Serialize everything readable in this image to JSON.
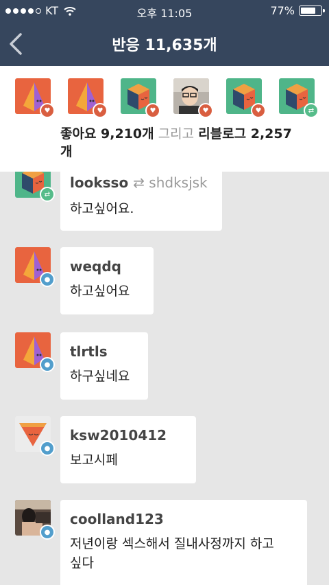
{
  "status_bar": {
    "carrier": "KT",
    "time": "오후 11:05",
    "battery_pct": "77%",
    "battery_level": 0.77,
    "signal_bars": 4
  },
  "nav": {
    "title": "반응 11,635개",
    "back_icon": "chevron-left-icon"
  },
  "summary": {
    "likes": "좋아요 9,210개",
    "conj": "그리고",
    "reblogs": "리블로그 2,257",
    "reblogs_unit": "개"
  },
  "avatars": [
    {
      "style": "pyramid",
      "badge": "like"
    },
    {
      "style": "pyramid",
      "badge": "like"
    },
    {
      "style": "cube",
      "badge": "like"
    },
    {
      "style": "photo",
      "badge": "like"
    },
    {
      "style": "cube",
      "badge": "like"
    },
    {
      "style": "cube",
      "badge": "reblog"
    }
  ],
  "notes": [
    {
      "user": "looksso",
      "reblogged_from": "shdksjsk",
      "text": "하고싶어요.",
      "avatar": "cube",
      "badge": "reblog"
    },
    {
      "user": "weqdq",
      "text": "하고싶어요",
      "avatar": "pyramid",
      "badge": "reply"
    },
    {
      "user": "tlrtls",
      "text": "하구싶네요",
      "avatar": "pyramid",
      "badge": "reply"
    },
    {
      "user": "ksw2010412",
      "text": "보고시페",
      "avatar": "cone",
      "badge": "reply"
    },
    {
      "user": "coolland123",
      "text_line1": "저년이랑 섹스해서 질내사정까지 하고",
      "text_line2": "싶다",
      "avatar": "photo2",
      "badge": "reply"
    }
  ],
  "colors": {
    "header": "#36465d",
    "background": "#e6e6e6",
    "like": "#d95e40",
    "reblog": "#56bc8a",
    "reply": "#529ecc"
  }
}
